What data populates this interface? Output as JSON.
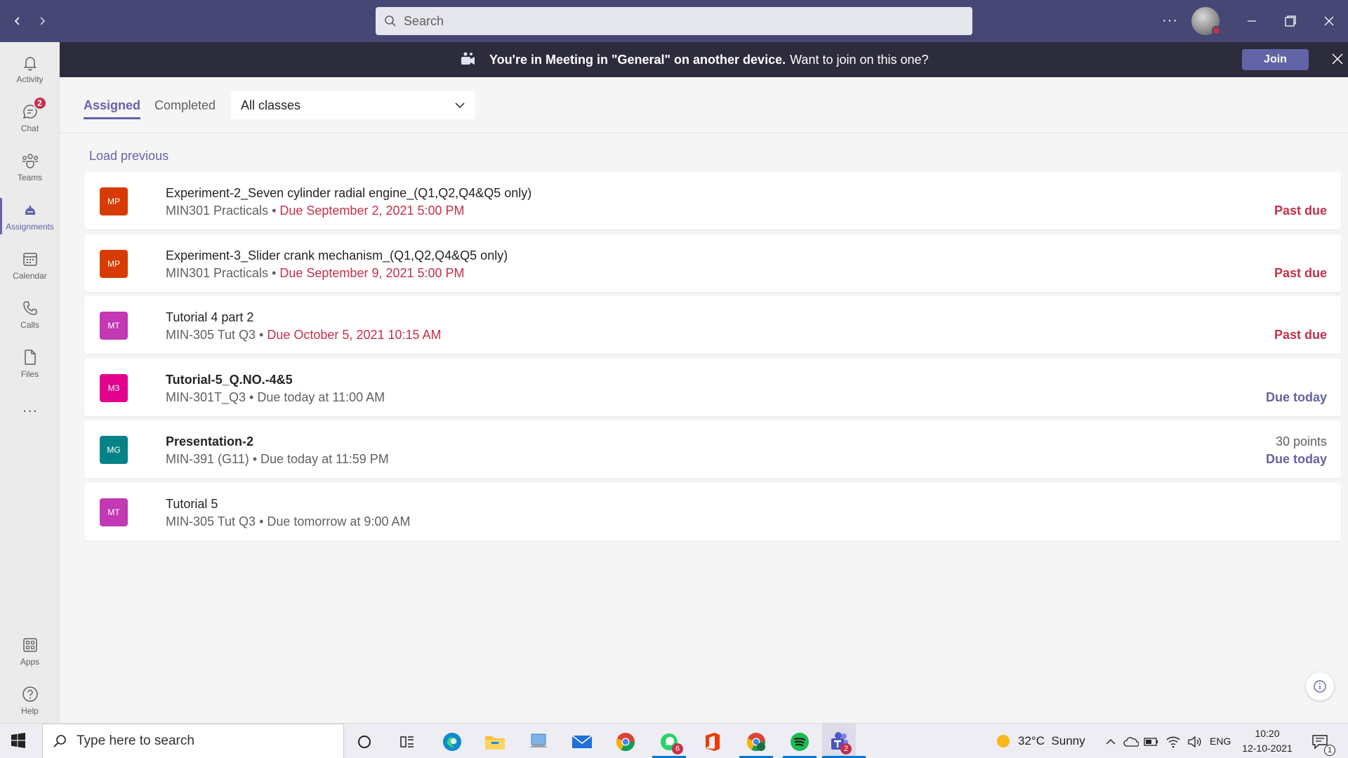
{
  "titlebar": {
    "search_placeholder": "Search",
    "more_label": "···",
    "colors": {
      "bar": "#464775"
    }
  },
  "rail": {
    "items": [
      {
        "label": "Activity",
        "icon": "bell-icon"
      },
      {
        "label": "Chat",
        "icon": "chat-icon",
        "badge": "2"
      },
      {
        "label": "Teams",
        "icon": "teams-icon"
      },
      {
        "label": "Assignments",
        "icon": "assignments-icon",
        "active": true
      },
      {
        "label": "Calendar",
        "icon": "calendar-icon"
      },
      {
        "label": "Calls",
        "icon": "phone-icon"
      },
      {
        "label": "Files",
        "icon": "file-icon"
      }
    ],
    "more_label": "···",
    "apps_label": "Apps",
    "help_label": "Help"
  },
  "banner": {
    "bold_text": "You're in Meeting in \"General\" on another device.",
    "text": "Want to join on this one?",
    "join_label": "Join"
  },
  "main": {
    "tabs": [
      {
        "label": "Assigned",
        "active": true
      },
      {
        "label": "Completed",
        "active": false
      }
    ],
    "class_filter": "All classes",
    "load_previous": "Load previous",
    "assignments": [
      {
        "avatar": "MP",
        "avatar_color": "#d83b01",
        "title": "Experiment-2_Seven cylinder radial engine_(Q1,Q2,Q4&Q5 only)",
        "class": "MIN301 Practicals",
        "due": "Due September 2, 2021 5:00 PM",
        "due_red": true,
        "status": "Past due",
        "status_color": "red",
        "bold": false
      },
      {
        "avatar": "MP",
        "avatar_color": "#d83b01",
        "title": "Experiment-3_Slider crank mechanism_(Q1,Q2,Q4&Q5 only)",
        "class": "MIN301 Practicals",
        "due": "Due September 9, 2021 5:00 PM",
        "due_red": true,
        "status": "Past due",
        "status_color": "red",
        "bold": false
      },
      {
        "avatar": "MT",
        "avatar_color": "#c239b3",
        "title": "Tutorial 4 part 2",
        "class": "MIN-305 Tut Q3",
        "due": "Due October 5, 2021 10:15 AM",
        "due_red": true,
        "status": "Past due",
        "status_color": "red",
        "bold": false
      },
      {
        "avatar": "M3",
        "avatar_color": "#e3008c",
        "title": "Tutorial-5_Q.NO.-4&5",
        "class": "MIN-301T_Q3",
        "due": "Due today at 11:00 AM",
        "due_red": false,
        "status": "Due today",
        "status_color": "purple",
        "bold": true
      },
      {
        "avatar": "MG",
        "avatar_color": "#038387",
        "title": "Presentation-2",
        "class": "MIN-391 (G11)",
        "due": "Due today at 11:59 PM",
        "due_red": false,
        "status": "Due today",
        "status_color": "purple",
        "points": "30 points",
        "bold": true
      },
      {
        "avatar": "MT",
        "avatar_color": "#c239b3",
        "title": "Tutorial 5",
        "class": "MIN-305 Tut Q3",
        "due": "Due tomorrow at 9:00 AM",
        "due_red": false,
        "status": "",
        "status_color": "",
        "bold": false
      }
    ]
  },
  "taskbar": {
    "search_placeholder": "Type here to search",
    "whatsapp_badge": "6",
    "teams_badge": "2",
    "weather": "32°C  Sunny",
    "language": "ENG",
    "time": "10:20",
    "date": "12-10-2021",
    "notification_count": "1"
  }
}
